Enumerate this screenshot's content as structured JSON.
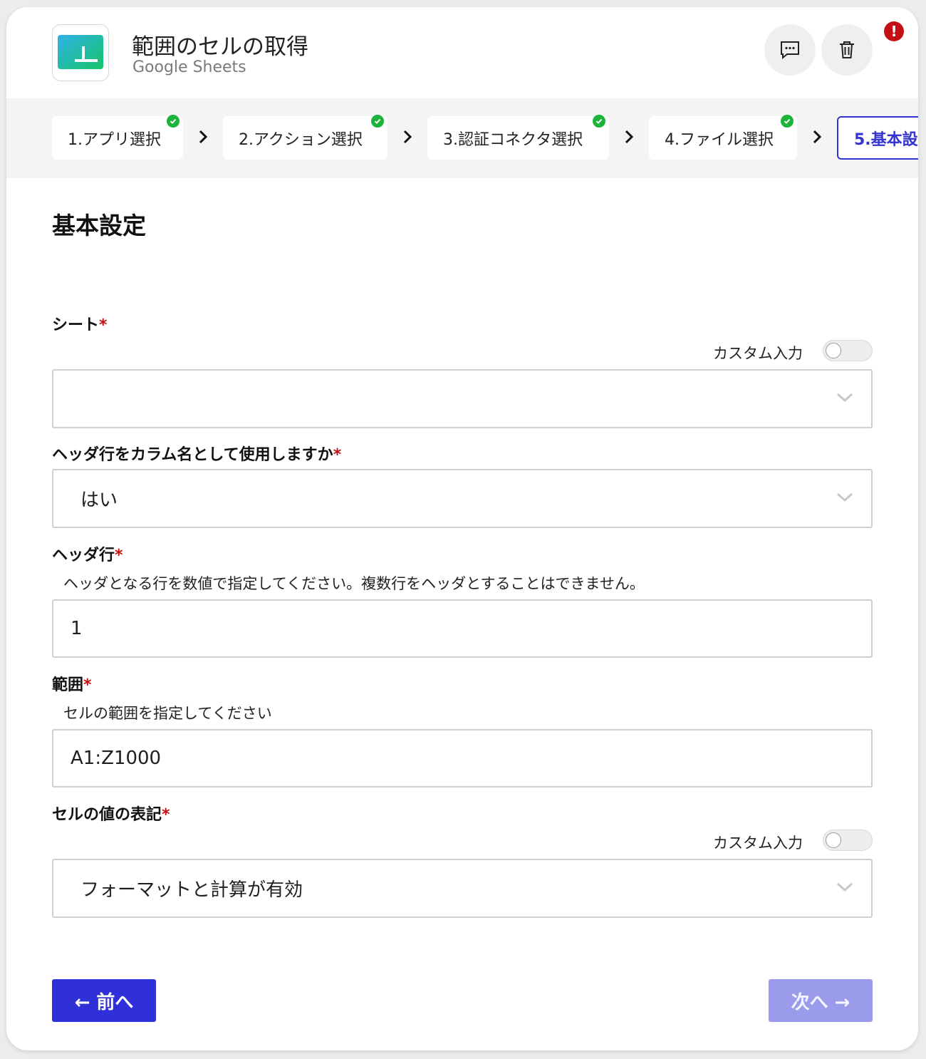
{
  "header": {
    "title": "範囲のセルの取得",
    "subtitle": "Google Sheets",
    "logo_icon": "google-sheets-logo",
    "chat_icon": "chat-icon",
    "trash_icon": "trash-icon",
    "alert_badge": "!"
  },
  "steps": [
    {
      "label": "1.アプリ選択",
      "completed": true
    },
    {
      "label": "2.アクション選択",
      "completed": true
    },
    {
      "label": "3.認証コネクタ選択",
      "completed": true
    },
    {
      "label": "4.ファイル選択",
      "completed": true
    },
    {
      "label": "5.基本設",
      "completed": false,
      "active": true
    }
  ],
  "section": {
    "title": "基本設定"
  },
  "form": {
    "sheet": {
      "label": "シート",
      "required_mark": "*",
      "custom_label": "カスタム入力",
      "custom_on": false,
      "value": ""
    },
    "use_header": {
      "label": "ヘッダ行をカラム名として使用しますか",
      "required_mark": "*",
      "value": "はい"
    },
    "header_row": {
      "label": "ヘッダ行",
      "required_mark": "*",
      "help": "ヘッダとなる行を数値で指定してください。複数行をヘッダとすることはできません。",
      "value": "1"
    },
    "range": {
      "label": "範囲",
      "required_mark": "*",
      "help": "セルの範囲を指定してください",
      "value": "A1:Z1000"
    },
    "value_render": {
      "label": "セルの値の表記",
      "required_mark": "*",
      "custom_label": "カスタム入力",
      "custom_on": false,
      "value": "フォーマットと計算が有効"
    }
  },
  "buttons": {
    "prev": "← 前へ",
    "next": "次へ →"
  },
  "colors": {
    "primary": "#3030d8",
    "primary_disabled": "#9b9bec",
    "check": "#1cb33b",
    "required": "#c40f14"
  }
}
